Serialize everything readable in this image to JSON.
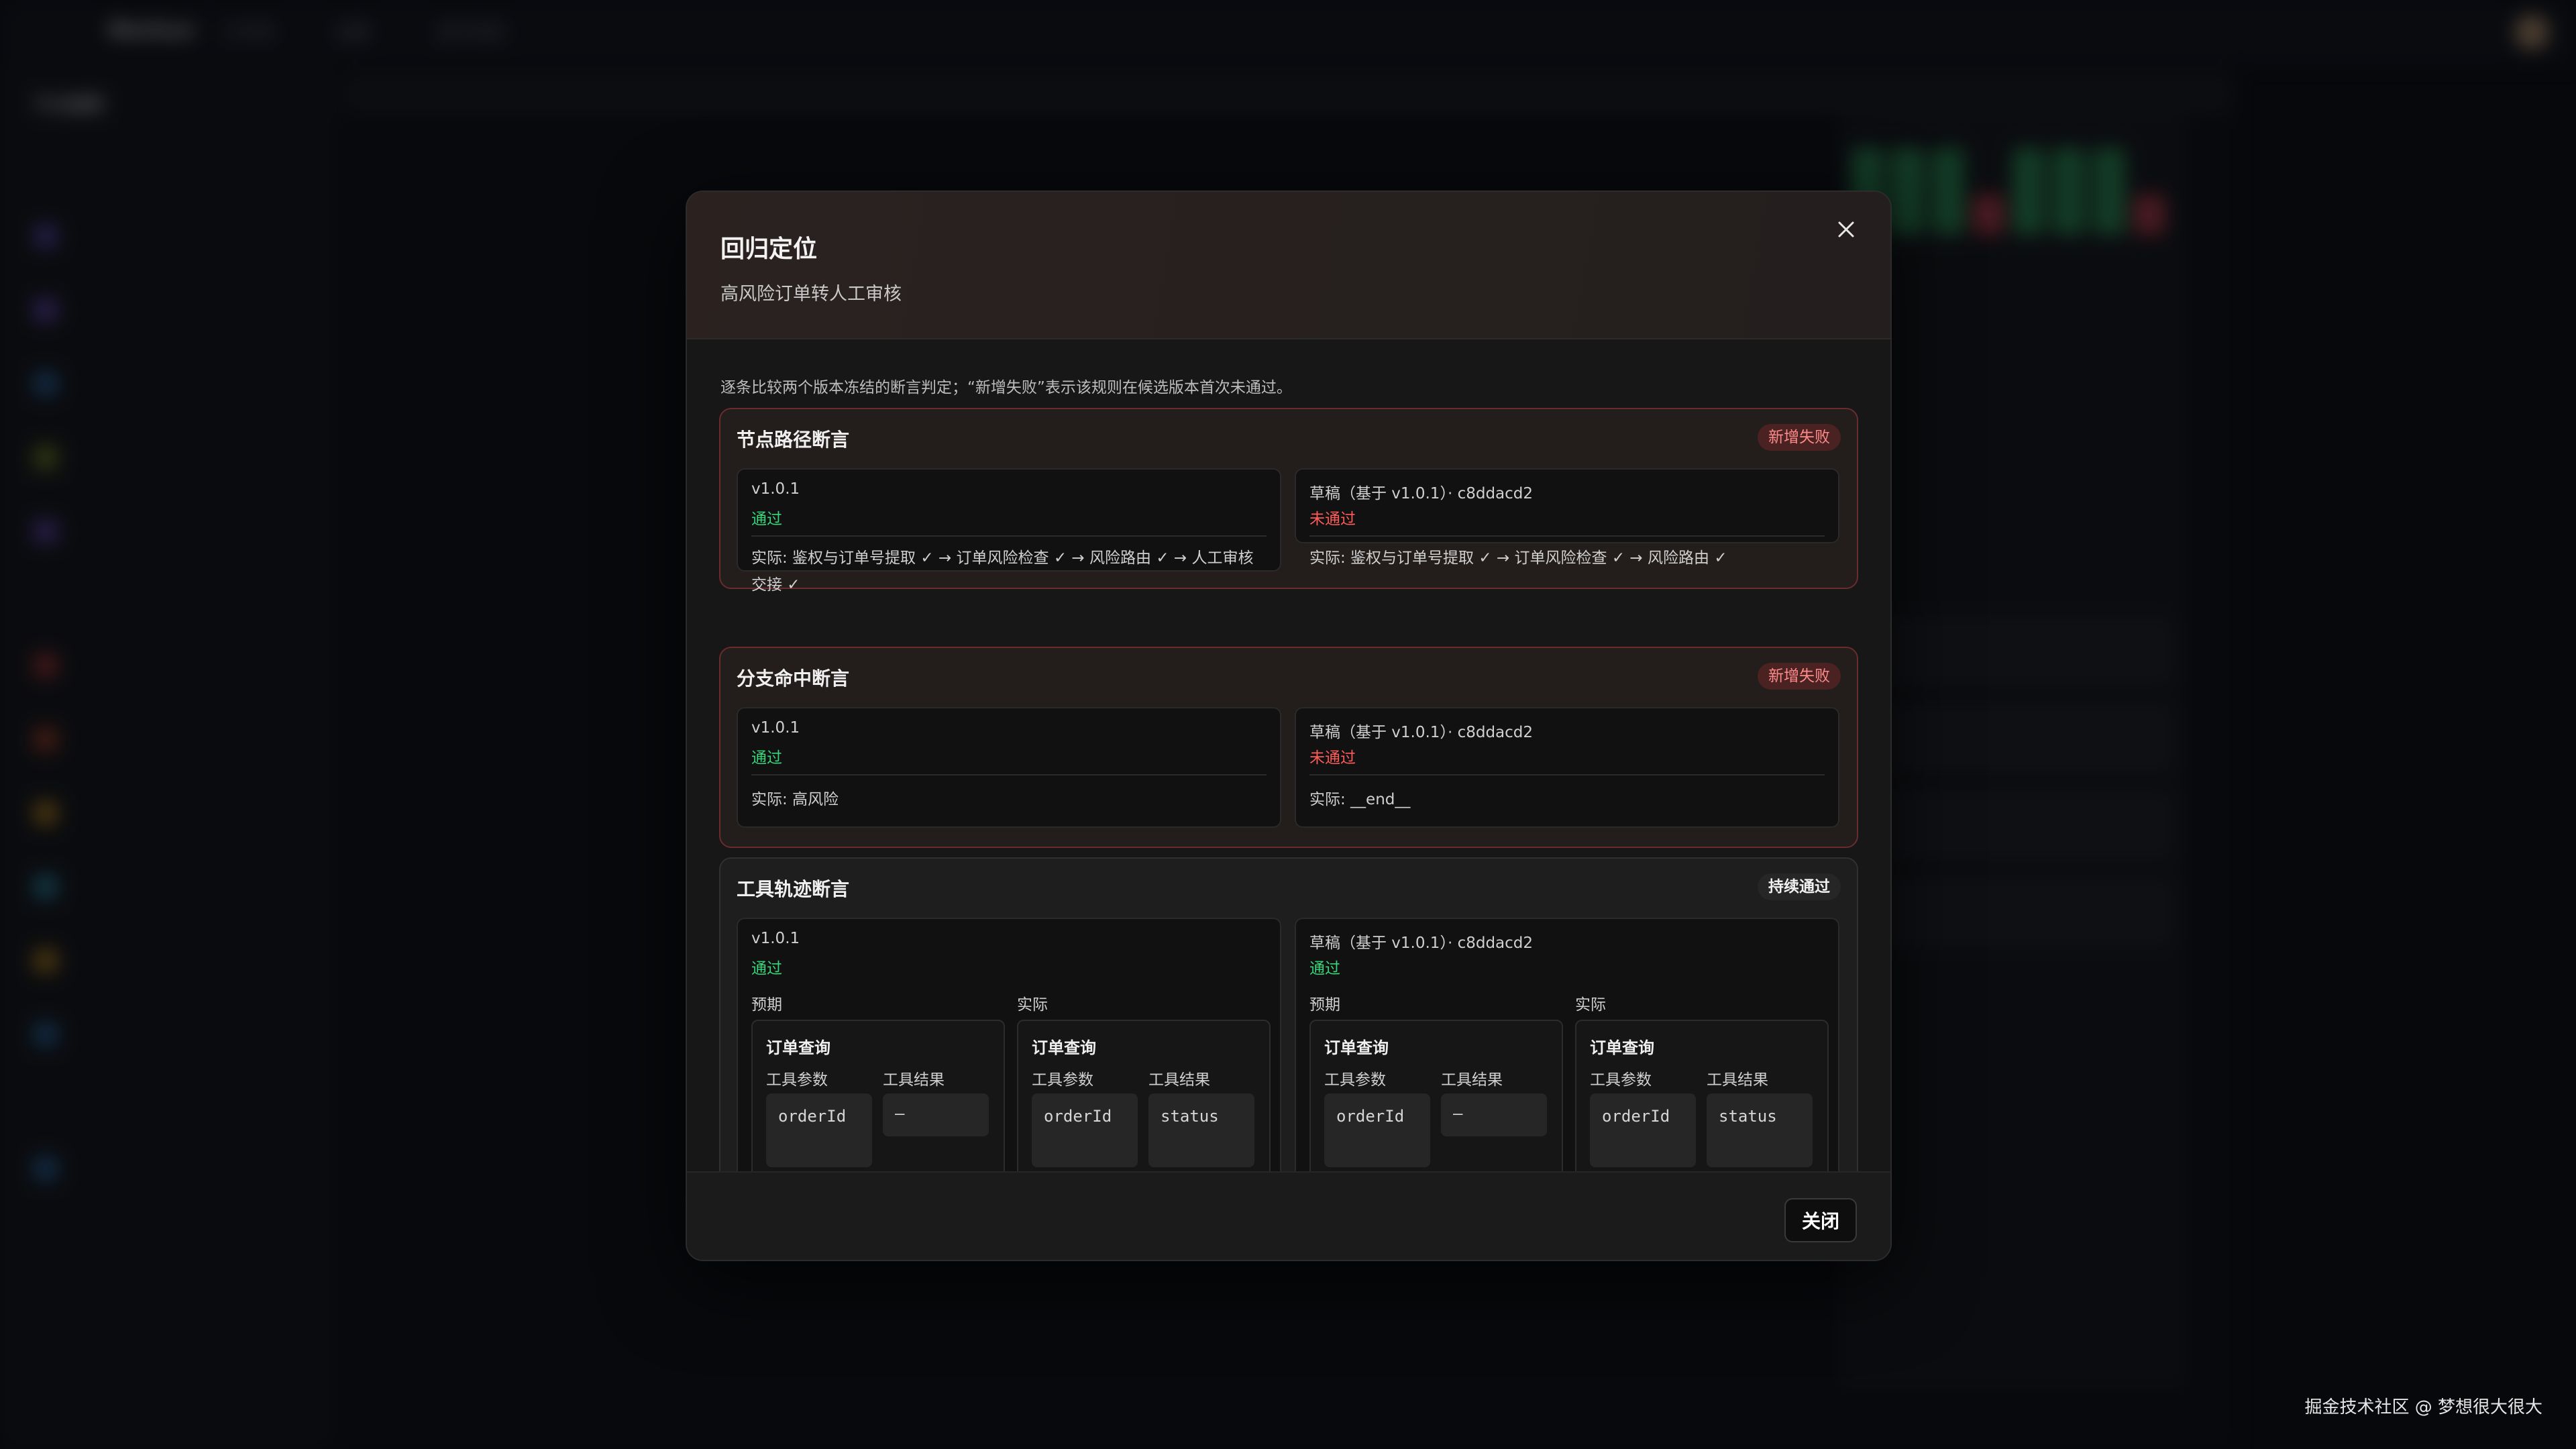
{
  "background": {
    "brand": "Workun",
    "nav": [
      "工作流",
      "运营",
      "运行历史"
    ],
    "sidebar_section": "节点编辑"
  },
  "dialog": {
    "title": "回归定位",
    "subtitle": "高风险订单转人工审核",
    "intro": "逐条比较两个版本冻结的断言判定；“新增失败”表示该规则在候选版本首次未通过。",
    "close_label": "关闭",
    "sections": [
      {
        "title": "节点路径断言",
        "badge": "新增失败",
        "left": {
          "version": "v1.0.1",
          "status": "通过",
          "actual": "实际: 鉴权与订单号提取 ✓ → 订单风险检查 ✓ → 风险路由 ✓ → 人工审核交接 ✓"
        },
        "right": {
          "version": "草稿（基于 v1.0.1）· c8ddacd2",
          "status": "未通过",
          "actual": "实际: 鉴权与订单号提取 ✓ → 订单风险检查 ✓ → 风险路由 ✓"
        }
      },
      {
        "title": "分支命中断言",
        "badge": "新增失败",
        "left": {
          "version": "v1.0.1",
          "status": "通过",
          "actual": "实际: 高风险"
        },
        "right": {
          "version": "草稿（基于 v1.0.1）· c8ddacd2",
          "status": "未通过",
          "actual": "实际: __end__"
        }
      },
      {
        "title": "工具轨迹断言",
        "badge": "持续通过",
        "left": {
          "version": "v1.0.1",
          "status": "通过",
          "expected_label": "预期",
          "actual_label": "实际",
          "expected": {
            "tool": "订单查询",
            "param_header": "工具参数",
            "result_header": "工具结果",
            "param": "orderId",
            "result": "—"
          },
          "actual": {
            "tool": "订单查询",
            "param_header": "工具参数",
            "result_header": "工具结果",
            "param": "orderId",
            "result": "status"
          }
        },
        "right": {
          "version": "草稿（基于 v1.0.1）· c8ddacd2",
          "status": "通过",
          "expected_label": "预期",
          "actual_label": "实际",
          "expected": {
            "tool": "订单查询",
            "param_header": "工具参数",
            "result_header": "工具结果",
            "param": "orderId",
            "result": "—"
          },
          "actual": {
            "tool": "订单查询",
            "param_header": "工具参数",
            "result_header": "工具结果",
            "param": "orderId",
            "result": "status"
          }
        }
      }
    ]
  },
  "watermark": "掘金技术社区 @ 梦想很大很大",
  "colors": {
    "pass": "#38d67a",
    "fail": "#ff5b5b",
    "fail_badge_bg": "#4a2222"
  }
}
